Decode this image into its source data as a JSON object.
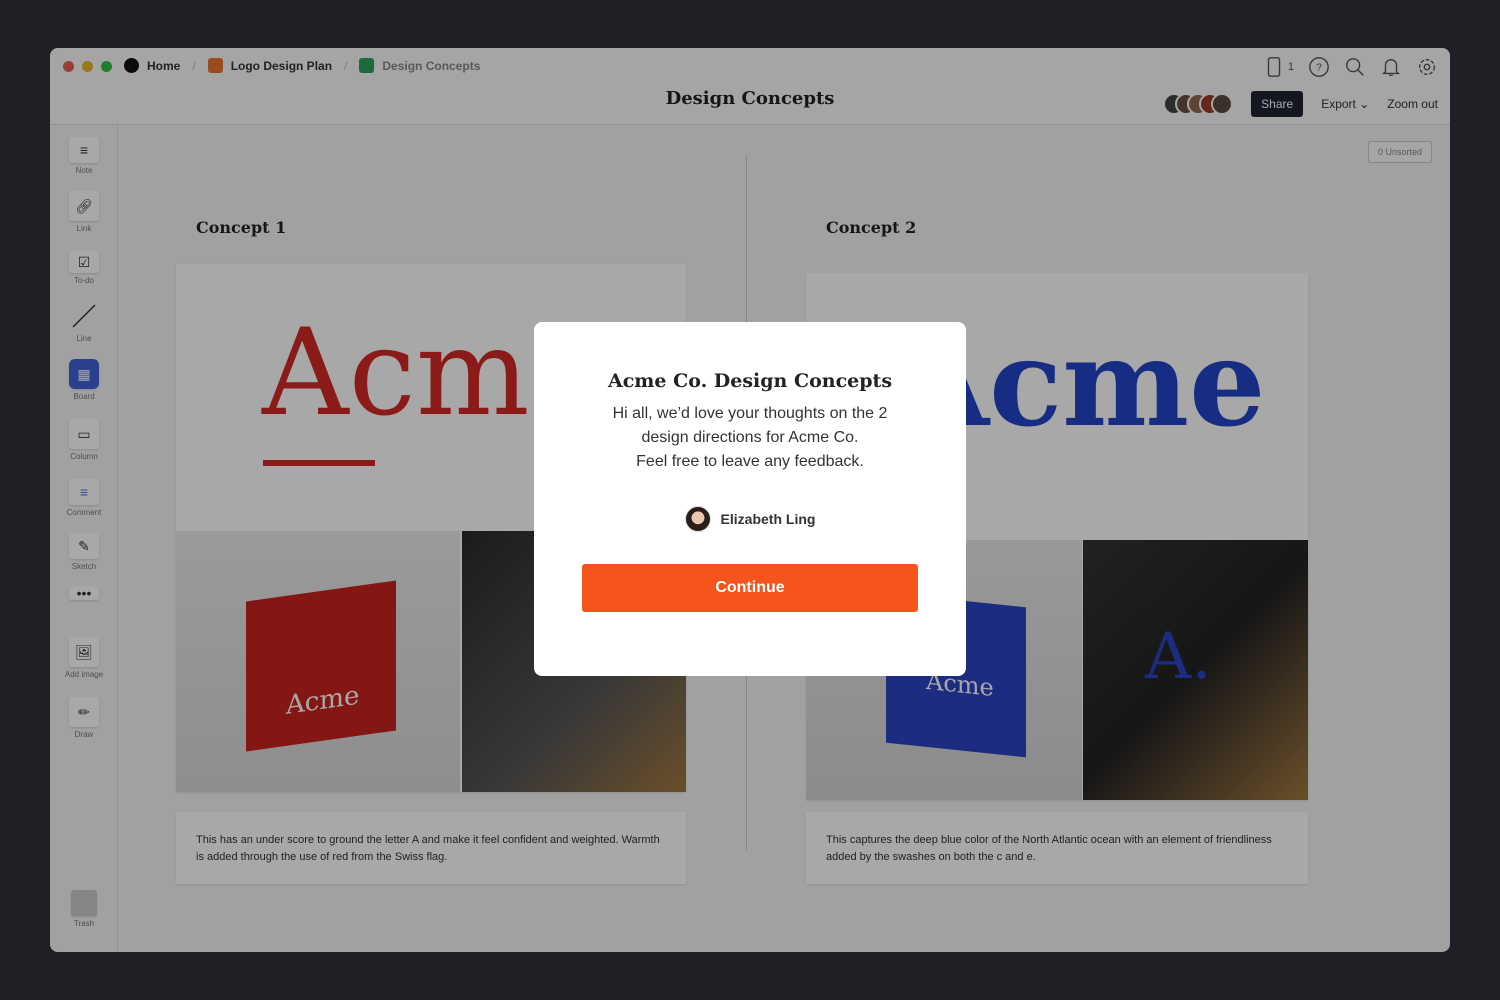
{
  "breadcrumb": [
    {
      "label": "Home",
      "color": "#111111"
    },
    {
      "label": "Logo Design Plan",
      "color": "#e8742d"
    },
    {
      "label": "Design Concepts",
      "color": "#2aa35c"
    }
  ],
  "header": {
    "title": "Design Concepts",
    "device_count": "1",
    "share": "Share",
    "export": "Export",
    "zoom_out": "Zoom out"
  },
  "sidebar": [
    "Note",
    "Link",
    "To-do",
    "Line",
    "Board",
    "Column",
    "Comment",
    "Sketch",
    "Add image",
    "Draw",
    "Trash"
  ],
  "canvas": {
    "unsorted": "0 Unsorted",
    "concepts": [
      {
        "title": "Concept 1",
        "logo": "Acme",
        "color": "#d42a26",
        "note": "This has an under score to ground the letter A and make it feel confident and weighted. Warmth is added through the use of red from the Swiss flag.",
        "bag_text": "Acme"
      },
      {
        "title": "Concept 2",
        "logo": "Acme",
        "color": "#2345c8",
        "note": "This captures the deep blue color of the North Atlantic ocean with an element of friendliness added by the swashes on both the c and e.",
        "bag_text": "Acme",
        "sign_text": "A."
      }
    ]
  },
  "modal": {
    "title": "Acme Co. Design Concepts",
    "lines": [
      "Hi all, we’d love your thoughts on the 2",
      "design directions for Acme Co.",
      "Feel free to leave any feedback."
    ],
    "user": "Elizabeth Ling",
    "button": "Continue"
  }
}
